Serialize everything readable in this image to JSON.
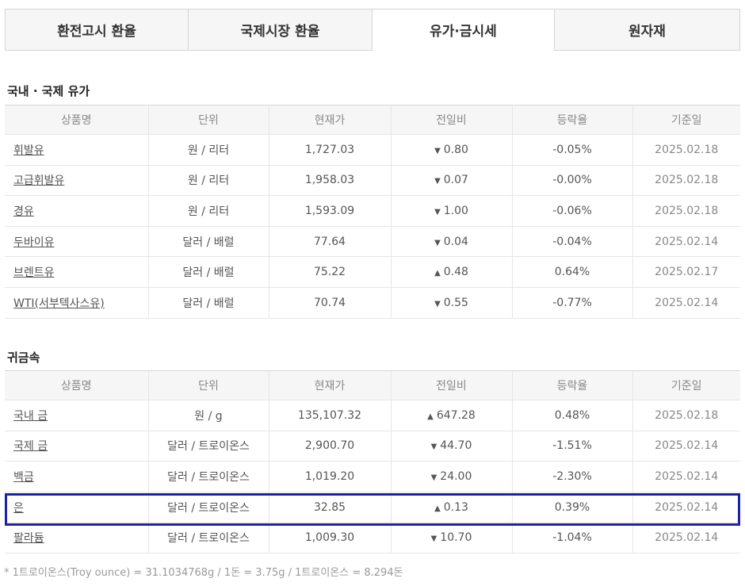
{
  "tabs": [
    {
      "label": "환전고시 환율",
      "active": false
    },
    {
      "label": "국제시장 환율",
      "active": false
    },
    {
      "label": "유가·금시세",
      "active": true
    },
    {
      "label": "원자재",
      "active": false
    }
  ],
  "oil": {
    "title": "국내 · 국제 유가",
    "headers": [
      "상품명",
      "단위",
      "현재가",
      "전일비",
      "등락율",
      "기준일"
    ],
    "rows": [
      {
        "name": "휘발유",
        "unit": "원 / 리터",
        "price": "1,727.03",
        "dir": "down",
        "change": "0.80",
        "rate": "-0.05%",
        "date": "2025.02.18"
      },
      {
        "name": "고급휘발유",
        "unit": "원 / 리터",
        "price": "1,958.03",
        "dir": "down",
        "change": "0.07",
        "rate": "-0.00%",
        "date": "2025.02.18"
      },
      {
        "name": "경유",
        "unit": "원 / 리터",
        "price": "1,593.09",
        "dir": "down",
        "change": "1.00",
        "rate": "-0.06%",
        "date": "2025.02.18"
      },
      {
        "name": "두바이유",
        "unit": "달러 / 배럴",
        "price": "77.64",
        "dir": "down",
        "change": "0.04",
        "rate": "-0.04%",
        "date": "2025.02.14"
      },
      {
        "name": "브렌트유",
        "unit": "달러 / 배럴",
        "price": "75.22",
        "dir": "up",
        "change": "0.48",
        "rate": "0.64%",
        "date": "2025.02.17"
      },
      {
        "name": "WTI(서부텍사스유)",
        "unit": "달러 / 배럴",
        "price": "70.74",
        "dir": "down",
        "change": "0.55",
        "rate": "-0.77%",
        "date": "2025.02.14"
      }
    ]
  },
  "metal": {
    "title": "귀금속",
    "headers": [
      "상품명",
      "단위",
      "현재가",
      "전일비",
      "등락율",
      "기준일"
    ],
    "rows": [
      {
        "name": "국내 금",
        "unit": "원 / g",
        "price": "135,107.32",
        "dir": "up",
        "change": "647.28",
        "rate": "0.48%",
        "date": "2025.02.18"
      },
      {
        "name": "국제 금",
        "unit": "달러 / 트로이온스",
        "price": "2,900.70",
        "dir": "down",
        "change": "44.70",
        "rate": "-1.51%",
        "date": "2025.02.14"
      },
      {
        "name": "백금",
        "unit": "달러 / 트로이온스",
        "price": "1,019.20",
        "dir": "down",
        "change": "24.00",
        "rate": "-2.30%",
        "date": "2025.02.14"
      },
      {
        "name": "은",
        "unit": "달러 / 트로이온스",
        "price": "32.85",
        "dir": "up",
        "change": "0.13",
        "rate": "0.39%",
        "date": "2025.02.14"
      },
      {
        "name": "팔라듐",
        "unit": "달러 / 트로이온스",
        "price": "1,009.30",
        "dir": "down",
        "change": "10.70",
        "rate": "-1.04%",
        "date": "2025.02.14"
      }
    ]
  },
  "symbols": {
    "up": "▲",
    "down": "▼"
  },
  "colors": {
    "up": "#d22121",
    "down": "#2a4fbd",
    "highlight": "#1c22a8"
  },
  "footnote": "* 1트로이온스(Troy ounce) = 31.1034768g / 1돈 = 3.75g / 1트로이온스 = 8.294돈"
}
